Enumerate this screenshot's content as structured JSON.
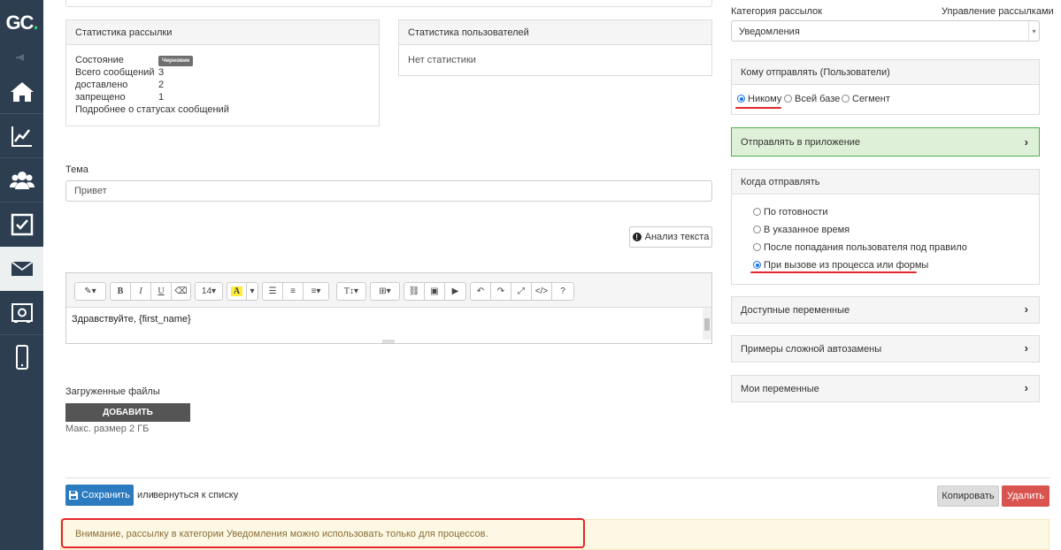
{
  "sidebar": {
    "logo_main": "GC",
    "logo_dot": ".",
    "items": [
      "home-icon",
      "chart-icon",
      "users-icon",
      "tasks-icon",
      "mail-icon",
      "safe-icon",
      "mobile-icon"
    ]
  },
  "mailing_stats": {
    "title": "Статистика рассылки",
    "state_label": "Состояние",
    "state_badge": "Черновик",
    "total_label": "Всего сообщений",
    "total_value": "3",
    "delivered_label": "доставлено",
    "delivered_value": "2",
    "forbidden_label": "запрещено",
    "forbidden_value": "1",
    "details_link": "Подробнее о статусах сообщений"
  },
  "user_stats": {
    "title": "Статистика пользователей",
    "empty": "Нет статистики"
  },
  "subject": {
    "label": "Тема",
    "value": "Привет"
  },
  "analyze_button": "Анализ текста",
  "editor": {
    "font_size": "14",
    "content": "Здравствуйте, {first_name}"
  },
  "files": {
    "label": "Загруженные файлы",
    "add_button": "ДОБАВИТЬ",
    "max_size": "Макс. размер 2 ГБ"
  },
  "footer": {
    "save_button": "Сохранить",
    "or_text": "или",
    "back_link": "вернуться к списку",
    "copy_button": "Копировать",
    "delete_button": "Удалить"
  },
  "warning": "Внимание, рассылку в категории Уведомления можно использовать только для процессов.",
  "right": {
    "category_label": "Категория рассылок",
    "manage_link": "Управление рассылками",
    "category_value": "Уведомления",
    "recipients": {
      "title": "Кому отправлять (Пользователи)",
      "options": [
        "Никому",
        "Всей базе",
        "Сегмент"
      ],
      "selected": "Никому"
    },
    "send_in_app": "Отправлять в приложение",
    "when": {
      "title": "Когда отправлять",
      "options": [
        "По готовности",
        "В указанное время",
        "После попадания пользователя под правило",
        "При вызове из процесса или формы"
      ],
      "selected": "При вызове из процесса или формы"
    },
    "sections": [
      "Доступные переменные",
      "Примеры сложной автозамены",
      "Мои переменные"
    ]
  },
  "colors": {
    "sidebar": "#2c3e50",
    "accent_green": "#2ecc71",
    "save_blue": "#2c7bc0",
    "delete_red": "#d9534f",
    "highlight_red": "#e3262c",
    "warning_bg": "#fcf8e3"
  }
}
